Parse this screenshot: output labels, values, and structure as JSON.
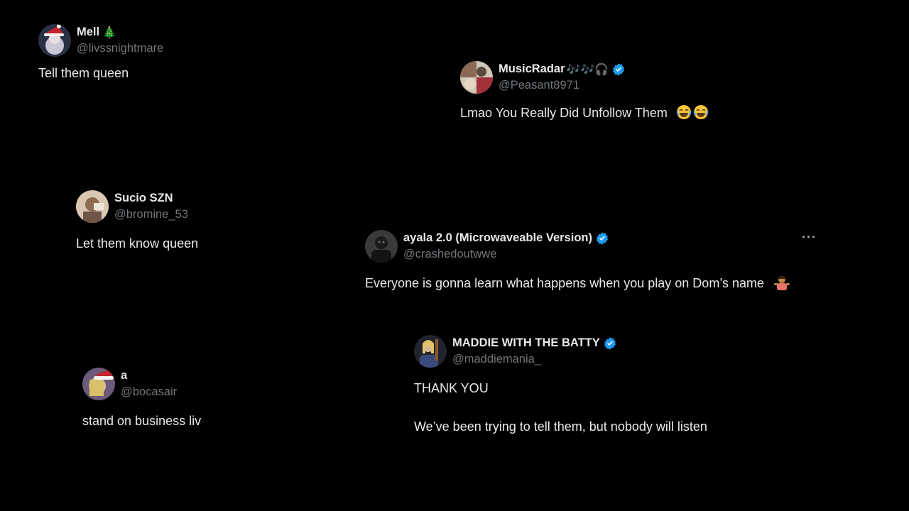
{
  "accent_colors": {
    "verified": "#1d9bf0",
    "background": "#000000",
    "text": "#e7e9ea",
    "handle": "#71767b"
  },
  "tweets": [
    {
      "name": "Mell",
      "name_emoji": "🎄",
      "handle": "@livssnightmare",
      "text": "Tell them queen",
      "verified": false,
      "avatar_icon": "avatar-santa-hat"
    },
    {
      "name": "MusicRadar",
      "name_emoji": "🎶🎶🎧",
      "handle": "@Peasant8971",
      "text": "Lmao You Really Did Unfollow Them",
      "text_emoji": "😂😂",
      "verified": true,
      "avatar_icon": "avatar-photo"
    },
    {
      "name": "Sucio SZN",
      "handle": "@bromine_53",
      "text": "Let them know queen",
      "verified": false,
      "avatar_icon": "avatar-photo"
    },
    {
      "name": "ayala 2.0 (Microwaveable Version)",
      "handle": "@crashedoutwwe",
      "text": "Everyone is gonna learn what happens when you play on Dom’s name",
      "text_emoji": "🤷🏽‍♂️",
      "verified": true,
      "more_label": "···",
      "avatar_icon": "avatar-photo"
    },
    {
      "name": "MADDIE WITH THE BATTY",
      "handle": "@maddiemania_",
      "text_lines": [
        "THANK YOU",
        "We’ve been trying to tell them, but nobody will listen"
      ],
      "verified": true,
      "avatar_icon": "avatar-photo"
    },
    {
      "name": "a",
      "handle": "@bocasair",
      "text": "stand on business liv",
      "verified": false,
      "avatar_icon": "avatar-santa-hat"
    }
  ]
}
